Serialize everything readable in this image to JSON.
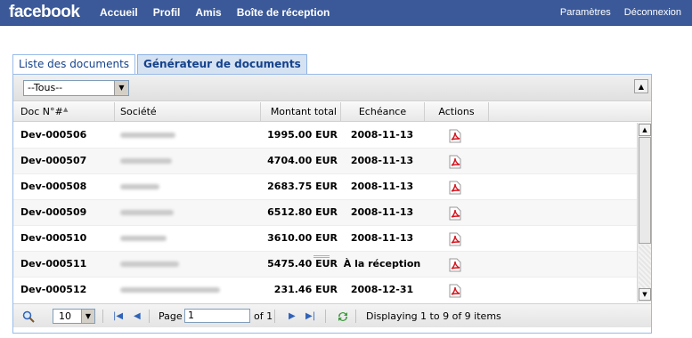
{
  "header": {
    "logo": "facebook",
    "nav": [
      "Accueil",
      "Profil",
      "Amis",
      "Boîte de réception"
    ],
    "right_links": [
      "Paramètres",
      "Déconnexion"
    ]
  },
  "tabs": [
    {
      "label": "Liste des documents",
      "active": true
    },
    {
      "label": "Générateur de documents",
      "active": false
    }
  ],
  "filter": {
    "value": "--Tous--"
  },
  "columns": [
    "Doc N°#",
    "Société",
    "Montant total",
    "Echéance",
    "Actions"
  ],
  "rows": [
    {
      "doc": "Dev-000506",
      "amount": "1995.00 EUR",
      "due": "2008-11-13"
    },
    {
      "doc": "Dev-000507",
      "amount": "4704.00 EUR",
      "due": "2008-11-13"
    },
    {
      "doc": "Dev-000508",
      "amount": "2683.75 EUR",
      "due": "2008-11-13"
    },
    {
      "doc": "Dev-000509",
      "amount": "6512.80 EUR",
      "due": "2008-11-13"
    },
    {
      "doc": "Dev-000510",
      "amount": "3610.00 EUR",
      "due": "2008-11-13"
    },
    {
      "doc": "Dev-000511",
      "amount": "5475.40 EUR",
      "due": "À la réception"
    },
    {
      "doc": "Dev-000512",
      "amount": "231.46 EUR",
      "due": "2008-12-31"
    }
  ],
  "pager": {
    "page_size": "10",
    "page_label": "Page",
    "page_value": "1",
    "of_label": "of 1",
    "summary": "Displaying 1 to 9 of 9 items"
  },
  "colors": {
    "brand": "#3b5998",
    "tab_text": "#15428b",
    "pdf_red": "#d6141e"
  },
  "icons": [
    "search-icon",
    "first-page-icon",
    "prev-page-icon",
    "next-page-icon",
    "last-page-icon",
    "refresh-icon",
    "pdf-icon"
  ]
}
